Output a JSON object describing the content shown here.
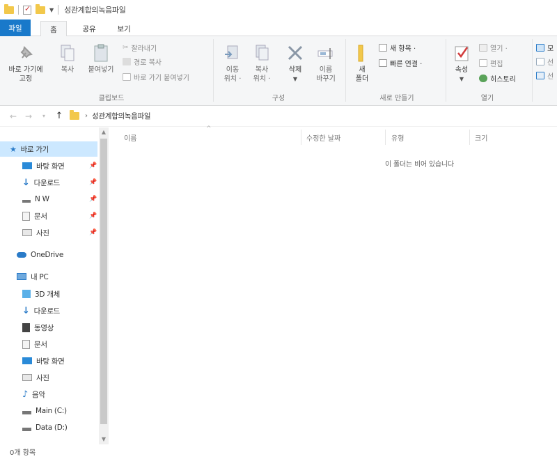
{
  "window": {
    "title": "성관계합의녹음파일"
  },
  "tabs": {
    "file": "파일",
    "home": "홈",
    "share": "공유",
    "view": "보기"
  },
  "ribbon": {
    "pin_quick": "바로 가기에\n고정",
    "copy": "복사",
    "paste": "붙여넣기",
    "cut": "잘라내기",
    "copy_path": "경로 복사",
    "paste_shortcut": "바로 가기 붙여넣기",
    "clipboard_group": "클립보드",
    "move_to": "이동\n위치 ·",
    "copy_to": "복사\n위치 ·",
    "delete": "삭제",
    "rename": "이름\n바꾸기",
    "organize_group": "구성",
    "new_folder": "새\n폴더",
    "new_item": "새 항목 ·",
    "easy_access": "빠른 연결 ·",
    "new_group": "새로 만들기",
    "properties": "속성",
    "open": "열기 ·",
    "edit": "편집",
    "history": "히스토리",
    "open_group": "열기",
    "cut_off_1": "모",
    "cut_off_2": "선",
    "cut_off_3": "선"
  },
  "address": {
    "path": "성관계합의녹음파일",
    "separator": "›"
  },
  "sidebar": {
    "quick_access": "바로 가기",
    "quick_items": [
      {
        "label": "바탕 화면"
      },
      {
        "label": "다운로드"
      },
      {
        "label": "N W"
      },
      {
        "label": "문서"
      },
      {
        "label": "사진"
      }
    ],
    "onedrive": "OneDrive",
    "this_pc": "내 PC",
    "pc_items": [
      {
        "label": "3D 개체"
      },
      {
        "label": "다운로드"
      },
      {
        "label": "동영상"
      },
      {
        "label": "문서"
      },
      {
        "label": "바탕 화면"
      },
      {
        "label": "사진"
      },
      {
        "label": "음악"
      },
      {
        "label": "Main (C:)"
      },
      {
        "label": "Data (D:)"
      }
    ]
  },
  "columns": {
    "name": "이름",
    "modified": "수정한 날짜",
    "type": "유형",
    "size": "크기"
  },
  "content": {
    "empty_message": "이 폴더는 비어 있습니다"
  },
  "status": {
    "count": "0개 항목"
  },
  "colors": {
    "accent": "#1979ca",
    "selected": "#cce8ff",
    "folder": "#f2c84b"
  }
}
